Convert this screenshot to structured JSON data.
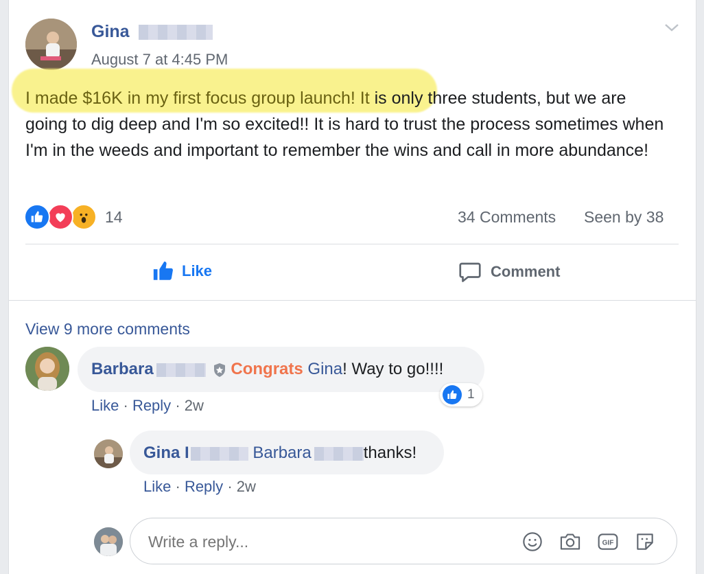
{
  "post": {
    "author": "Gina",
    "timestamp": "August 7 at 4:45 PM",
    "text_highlighted": "I made $16K in my first focus group launch! It",
    "text_rest": " is only three students, but we are going to dig deep and I'm so excited!! It is hard to trust the process sometimes when I'm in the weeds and important to remember the wins and call in more abundance!",
    "reaction_count": "14",
    "comments_count": "34 Comments",
    "seen_by": "Seen by 38"
  },
  "actions": {
    "like": "Like",
    "comment": "Comment"
  },
  "comments": {
    "view_more": "View 9 more comments",
    "first": {
      "author": "Barbara",
      "text_congrats": "Congrats",
      "text_mention": "Gina",
      "text_rest": "! Way to go!!!!",
      "like_label": "Like",
      "reply_label": "Reply",
      "age": "2w",
      "reaction_count": "1"
    },
    "reply": {
      "author": "Gina I",
      "mention": "Barbara",
      "text": "thanks!",
      "like_label": "Like",
      "reply_label": "Reply",
      "age": "2w"
    }
  },
  "composer": {
    "placeholder": "Write a reply..."
  },
  "colors": {
    "brand": "#385898",
    "like_blue": "#1877f2",
    "highlight": "#f9f07b",
    "congrats": "#f0744c"
  },
  "icons": [
    "chevron-down-icon",
    "like-reaction-icon",
    "love-reaction-icon",
    "wow-reaction-icon",
    "thumbs-up-icon",
    "comment-icon",
    "admin-badge-icon",
    "emoji-icon",
    "camera-icon",
    "gif-icon",
    "sticker-icon"
  ]
}
